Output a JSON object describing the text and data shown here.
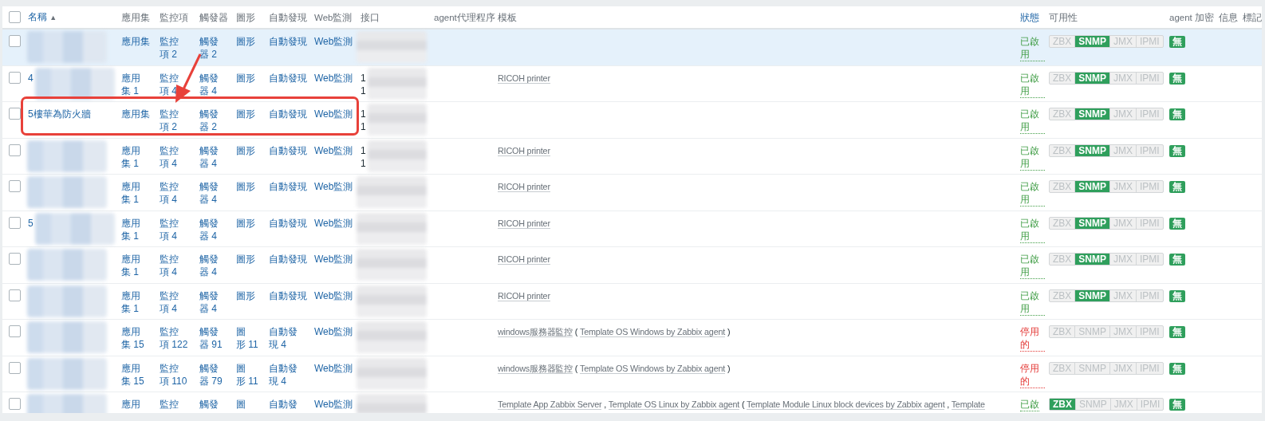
{
  "header": {
    "select_all_checked": false,
    "columns": [
      {
        "label": "名稱",
        "link": true,
        "sort_indicator": "▲"
      },
      {
        "label": "應用集",
        "link": false
      },
      {
        "label": "監控項",
        "link": false
      },
      {
        "label": "觸發器",
        "link": false
      },
      {
        "label": "圖形",
        "link": false
      },
      {
        "label": "自動發現",
        "link": false
      },
      {
        "label": "Web監測",
        "link": false
      },
      {
        "label": "接口",
        "link": false
      },
      {
        "label": "agent代理程序",
        "link": false
      },
      {
        "label": "模板",
        "link": false
      },
      {
        "label": "狀態",
        "link": true
      },
      {
        "label": "可用性",
        "link": false
      },
      {
        "label": "agent 加密",
        "link": false
      },
      {
        "label": "信息",
        "link": false
      },
      {
        "label": "標記",
        "link": false
      }
    ]
  },
  "rows": [
    {
      "checked": false,
      "highlighted": true,
      "annotated": false,
      "name": {
        "blurred": true
      },
      "links": [
        {
          "label": "應用集"
        },
        {
          "label": "監控項",
          "count": "2"
        },
        {
          "label": "觸發器",
          "count": "2"
        },
        {
          "label": "圖形"
        },
        {
          "label": "自動發現"
        },
        {
          "label": "Web監測"
        }
      ],
      "interface": {
        "blurred": true
      },
      "status": {
        "kind": "enabled",
        "text": "已啟用"
      },
      "availability": [
        {
          "label": "ZBX",
          "on": false
        },
        {
          "label": "SNMP",
          "on": true
        },
        {
          "label": "JMX",
          "on": false
        },
        {
          "label": "IPMI",
          "on": false
        }
      ],
      "encryption": "無"
    },
    {
      "checked": false,
      "highlighted": false,
      "annotated": false,
      "name": {
        "fragment": "4",
        "blurred": true
      },
      "links": [
        {
          "label": "應用集",
          "count": "1"
        },
        {
          "label": "監控項",
          "count": "4"
        },
        {
          "label": "觸發器",
          "count": "4"
        },
        {
          "label": "圖形"
        },
        {
          "label": "自動發現"
        },
        {
          "label": "Web監測"
        }
      ],
      "interface": {
        "fragments": [
          "1",
          "1"
        ],
        "blurred": true
      },
      "templates": [
        {
          "text": "RICOH printer",
          "link": true
        }
      ],
      "status": {
        "kind": "enabled",
        "text": "已啟用"
      },
      "availability": [
        {
          "label": "ZBX",
          "on": false
        },
        {
          "label": "SNMP",
          "on": true
        },
        {
          "label": "JMX",
          "on": false
        },
        {
          "label": "IPMI",
          "on": false
        }
      ],
      "encryption": "無"
    },
    {
      "checked": false,
      "highlighted": false,
      "annotated": true,
      "name": {
        "text": "5樓華為防火牆",
        "blurred": false
      },
      "links": [
        {
          "label": "應用集"
        },
        {
          "label": "監控項",
          "count": "2"
        },
        {
          "label": "觸發器",
          "count": "2"
        },
        {
          "label": "圖形"
        },
        {
          "label": "自動發現"
        },
        {
          "label": "Web監測"
        }
      ],
      "interface": {
        "fragments": [
          "1",
          "1"
        ],
        "blurred": true
      },
      "status": {
        "kind": "enabled",
        "text": "已啟用"
      },
      "availability": [
        {
          "label": "ZBX",
          "on": false
        },
        {
          "label": "SNMP",
          "on": true
        },
        {
          "label": "JMX",
          "on": false
        },
        {
          "label": "IPMI",
          "on": false
        }
      ],
      "encryption": "無"
    },
    {
      "checked": false,
      "highlighted": false,
      "annotated": false,
      "name": {
        "blurred": true
      },
      "links": [
        {
          "label": "應用集",
          "count": "1"
        },
        {
          "label": "監控項",
          "count": "4"
        },
        {
          "label": "觸發器",
          "count": "4"
        },
        {
          "label": "圖形"
        },
        {
          "label": "自動發現"
        },
        {
          "label": "Web監測"
        }
      ],
      "interface": {
        "fragments": [
          "1",
          "1"
        ],
        "blurred": true
      },
      "templates": [
        {
          "text": "RICOH printer",
          "link": true
        }
      ],
      "status": {
        "kind": "enabled",
        "text": "已啟用"
      },
      "availability": [
        {
          "label": "ZBX",
          "on": false
        },
        {
          "label": "SNMP",
          "on": true
        },
        {
          "label": "JMX",
          "on": false
        },
        {
          "label": "IPMI",
          "on": false
        }
      ],
      "encryption": "無"
    },
    {
      "checked": false,
      "highlighted": false,
      "annotated": false,
      "name": {
        "blurred": true
      },
      "links": [
        {
          "label": "應用集",
          "count": "1"
        },
        {
          "label": "監控項",
          "count": "4"
        },
        {
          "label": "觸發器",
          "count": "4"
        },
        {
          "label": "圖形"
        },
        {
          "label": "自動發現"
        },
        {
          "label": "Web監測"
        }
      ],
      "interface": {
        "blurred": true
      },
      "templates": [
        {
          "text": "RICOH printer",
          "link": true
        }
      ],
      "status": {
        "kind": "enabled",
        "text": "已啟用"
      },
      "availability": [
        {
          "label": "ZBX",
          "on": false
        },
        {
          "label": "SNMP",
          "on": true
        },
        {
          "label": "JMX",
          "on": false
        },
        {
          "label": "IPMI",
          "on": false
        }
      ],
      "encryption": "無"
    },
    {
      "checked": false,
      "highlighted": false,
      "annotated": false,
      "name": {
        "fragment": "5",
        "blurred": true
      },
      "links": [
        {
          "label": "應用集",
          "count": "1"
        },
        {
          "label": "監控項",
          "count": "4"
        },
        {
          "label": "觸發器",
          "count": "4"
        },
        {
          "label": "圖形"
        },
        {
          "label": "自動發現"
        },
        {
          "label": "Web監測"
        }
      ],
      "interface": {
        "blurred": true
      },
      "templates": [
        {
          "text": "RICOH printer",
          "link": true
        }
      ],
      "status": {
        "kind": "enabled",
        "text": "已啟用"
      },
      "availability": [
        {
          "label": "ZBX",
          "on": false
        },
        {
          "label": "SNMP",
          "on": true
        },
        {
          "label": "JMX",
          "on": false
        },
        {
          "label": "IPMI",
          "on": false
        }
      ],
      "encryption": "無"
    },
    {
      "checked": false,
      "highlighted": false,
      "annotated": false,
      "name": {
        "blurred": true
      },
      "links": [
        {
          "label": "應用集",
          "count": "1"
        },
        {
          "label": "監控項",
          "count": "4"
        },
        {
          "label": "觸發器",
          "count": "4"
        },
        {
          "label": "圖形"
        },
        {
          "label": "自動發現"
        },
        {
          "label": "Web監測"
        }
      ],
      "interface": {
        "blurred": true
      },
      "templates": [
        {
          "text": "RICOH printer",
          "link": true
        }
      ],
      "status": {
        "kind": "enabled",
        "text": "已啟用"
      },
      "availability": [
        {
          "label": "ZBX",
          "on": false
        },
        {
          "label": "SNMP",
          "on": true
        },
        {
          "label": "JMX",
          "on": false
        },
        {
          "label": "IPMI",
          "on": false
        }
      ],
      "encryption": "無"
    },
    {
      "checked": false,
      "highlighted": false,
      "annotated": false,
      "name": {
        "blurred": true
      },
      "links": [
        {
          "label": "應用集",
          "count": "1"
        },
        {
          "label": "監控項",
          "count": "4"
        },
        {
          "label": "觸發器",
          "count": "4"
        },
        {
          "label": "圖形"
        },
        {
          "label": "自動發現"
        },
        {
          "label": "Web監測"
        }
      ],
      "interface": {
        "blurred": true
      },
      "templates": [
        {
          "text": "RICOH printer",
          "link": true
        }
      ],
      "status": {
        "kind": "enabled",
        "text": "已啟用"
      },
      "availability": [
        {
          "label": "ZBX",
          "on": false
        },
        {
          "label": "SNMP",
          "on": true
        },
        {
          "label": "JMX",
          "on": false
        },
        {
          "label": "IPMI",
          "on": false
        }
      ],
      "encryption": "無"
    },
    {
      "checked": false,
      "highlighted": false,
      "annotated": false,
      "name": {
        "blurred": true
      },
      "links": [
        {
          "label": "應用集",
          "count": "15"
        },
        {
          "label": "監控項",
          "count": "122"
        },
        {
          "label": "觸發器",
          "count": "91"
        },
        {
          "label": "圖形",
          "count": "11"
        },
        {
          "label": "自動發現",
          "count": "4"
        },
        {
          "label": "Web監測"
        }
      ],
      "interface": {
        "blurred": true
      },
      "templates": [
        {
          "text": "windows服務器監控",
          "link": true
        },
        {
          "text": "(",
          "link": false
        },
        {
          "text": "Template OS Windows by Zabbix agent",
          "link": true
        },
        {
          "text": ")",
          "link": false
        }
      ],
      "status": {
        "kind": "disabled",
        "text": "停用的"
      },
      "availability": [
        {
          "label": "ZBX",
          "on": false
        },
        {
          "label": "SNMP",
          "on": false
        },
        {
          "label": "JMX",
          "on": false
        },
        {
          "label": "IPMI",
          "on": false
        }
      ],
      "encryption": "無"
    },
    {
      "checked": false,
      "highlighted": false,
      "annotated": false,
      "name": {
        "blurred": true
      },
      "links": [
        {
          "label": "應用集",
          "count": "15"
        },
        {
          "label": "監控項",
          "count": "110"
        },
        {
          "label": "觸發器",
          "count": "79"
        },
        {
          "label": "圖形",
          "count": "11"
        },
        {
          "label": "自動發現",
          "count": "4"
        },
        {
          "label": "Web監測"
        }
      ],
      "interface": {
        "blurred": true
      },
      "templates": [
        {
          "text": "windows服務器監控",
          "link": true
        },
        {
          "text": "(",
          "link": false
        },
        {
          "text": "Template OS Windows by Zabbix agent",
          "link": true
        },
        {
          "text": ")",
          "link": false
        }
      ],
      "status": {
        "kind": "disabled",
        "text": "停用的"
      },
      "availability": [
        {
          "label": "ZBX",
          "on": false
        },
        {
          "label": "SNMP",
          "on": false
        },
        {
          "label": "JMX",
          "on": false
        },
        {
          "label": "IPMI",
          "on": false
        }
      ],
      "encryption": "無"
    },
    {
      "checked": false,
      "highlighted": false,
      "annotated": false,
      "name": {
        "blurred": true
      },
      "links": [
        {
          "label": "應用"
        },
        {
          "label": "監控"
        },
        {
          "label": "觸發"
        },
        {
          "label": "圖"
        },
        {
          "label": "自動發"
        },
        {
          "label": "Web監測"
        }
      ],
      "interface": {
        "blurred": true
      },
      "templates": [
        {
          "text": "Template App Zabbix Server",
          "link": true
        },
        {
          "text": ",",
          "link": false
        },
        {
          "text": "Template OS Linux by Zabbix agent",
          "link": true
        },
        {
          "text": "(",
          "link": false
        },
        {
          "text": "Template Module Linux block devices by Zabbix agent",
          "link": true
        },
        {
          "text": ",",
          "link": false
        },
        {
          "text": "Template",
          "link": true
        }
      ],
      "status": {
        "kind": "enabled",
        "text": "已啟"
      },
      "availability": [
        {
          "label": "ZBX",
          "on": true
        },
        {
          "label": "SNMP",
          "on": false
        },
        {
          "label": "JMX",
          "on": false
        },
        {
          "label": "IPMI",
          "on": false
        }
      ],
      "encryption": "無"
    }
  ]
}
